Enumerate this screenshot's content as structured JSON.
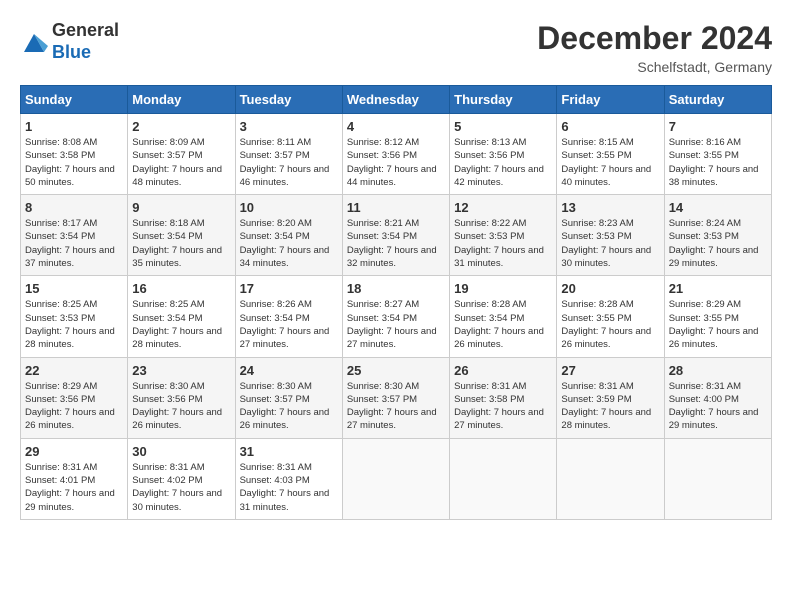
{
  "header": {
    "logo_line1": "General",
    "logo_line2": "Blue",
    "month_title": "December 2024",
    "location": "Schelfstadt, Germany"
  },
  "days_of_week": [
    "Sunday",
    "Monday",
    "Tuesday",
    "Wednesday",
    "Thursday",
    "Friday",
    "Saturday"
  ],
  "weeks": [
    [
      {
        "day": "1",
        "sunrise": "8:08 AM",
        "sunset": "3:58 PM",
        "daylight": "7 hours and 50 minutes"
      },
      {
        "day": "2",
        "sunrise": "8:09 AM",
        "sunset": "3:57 PM",
        "daylight": "7 hours and 48 minutes"
      },
      {
        "day": "3",
        "sunrise": "8:11 AM",
        "sunset": "3:57 PM",
        "daylight": "7 hours and 46 minutes"
      },
      {
        "day": "4",
        "sunrise": "8:12 AM",
        "sunset": "3:56 PM",
        "daylight": "7 hours and 44 minutes"
      },
      {
        "day": "5",
        "sunrise": "8:13 AM",
        "sunset": "3:56 PM",
        "daylight": "7 hours and 42 minutes"
      },
      {
        "day": "6",
        "sunrise": "8:15 AM",
        "sunset": "3:55 PM",
        "daylight": "7 hours and 40 minutes"
      },
      {
        "day": "7",
        "sunrise": "8:16 AM",
        "sunset": "3:55 PM",
        "daylight": "7 hours and 38 minutes"
      }
    ],
    [
      {
        "day": "8",
        "sunrise": "8:17 AM",
        "sunset": "3:54 PM",
        "daylight": "7 hours and 37 minutes"
      },
      {
        "day": "9",
        "sunrise": "8:18 AM",
        "sunset": "3:54 PM",
        "daylight": "7 hours and 35 minutes"
      },
      {
        "day": "10",
        "sunrise": "8:20 AM",
        "sunset": "3:54 PM",
        "daylight": "7 hours and 34 minutes"
      },
      {
        "day": "11",
        "sunrise": "8:21 AM",
        "sunset": "3:54 PM",
        "daylight": "7 hours and 32 minutes"
      },
      {
        "day": "12",
        "sunrise": "8:22 AM",
        "sunset": "3:53 PM",
        "daylight": "7 hours and 31 minutes"
      },
      {
        "day": "13",
        "sunrise": "8:23 AM",
        "sunset": "3:53 PM",
        "daylight": "7 hours and 30 minutes"
      },
      {
        "day": "14",
        "sunrise": "8:24 AM",
        "sunset": "3:53 PM",
        "daylight": "7 hours and 29 minutes"
      }
    ],
    [
      {
        "day": "15",
        "sunrise": "8:25 AM",
        "sunset": "3:53 PM",
        "daylight": "7 hours and 28 minutes"
      },
      {
        "day": "16",
        "sunrise": "8:25 AM",
        "sunset": "3:54 PM",
        "daylight": "7 hours and 28 minutes"
      },
      {
        "day": "17",
        "sunrise": "8:26 AM",
        "sunset": "3:54 PM",
        "daylight": "7 hours and 27 minutes"
      },
      {
        "day": "18",
        "sunrise": "8:27 AM",
        "sunset": "3:54 PM",
        "daylight": "7 hours and 27 minutes"
      },
      {
        "day": "19",
        "sunrise": "8:28 AM",
        "sunset": "3:54 PM",
        "daylight": "7 hours and 26 minutes"
      },
      {
        "day": "20",
        "sunrise": "8:28 AM",
        "sunset": "3:55 PM",
        "daylight": "7 hours and 26 minutes"
      },
      {
        "day": "21",
        "sunrise": "8:29 AM",
        "sunset": "3:55 PM",
        "daylight": "7 hours and 26 minutes"
      }
    ],
    [
      {
        "day": "22",
        "sunrise": "8:29 AM",
        "sunset": "3:56 PM",
        "daylight": "7 hours and 26 minutes"
      },
      {
        "day": "23",
        "sunrise": "8:30 AM",
        "sunset": "3:56 PM",
        "daylight": "7 hours and 26 minutes"
      },
      {
        "day": "24",
        "sunrise": "8:30 AM",
        "sunset": "3:57 PM",
        "daylight": "7 hours and 26 minutes"
      },
      {
        "day": "25",
        "sunrise": "8:30 AM",
        "sunset": "3:57 PM",
        "daylight": "7 hours and 27 minutes"
      },
      {
        "day": "26",
        "sunrise": "8:31 AM",
        "sunset": "3:58 PM",
        "daylight": "7 hours and 27 minutes"
      },
      {
        "day": "27",
        "sunrise": "8:31 AM",
        "sunset": "3:59 PM",
        "daylight": "7 hours and 28 minutes"
      },
      {
        "day": "28",
        "sunrise": "8:31 AM",
        "sunset": "4:00 PM",
        "daylight": "7 hours and 29 minutes"
      }
    ],
    [
      {
        "day": "29",
        "sunrise": "8:31 AM",
        "sunset": "4:01 PM",
        "daylight": "7 hours and 29 minutes"
      },
      {
        "day": "30",
        "sunrise": "8:31 AM",
        "sunset": "4:02 PM",
        "daylight": "7 hours and 30 minutes"
      },
      {
        "day": "31",
        "sunrise": "8:31 AM",
        "sunset": "4:03 PM",
        "daylight": "7 hours and 31 minutes"
      },
      null,
      null,
      null,
      null
    ]
  ]
}
